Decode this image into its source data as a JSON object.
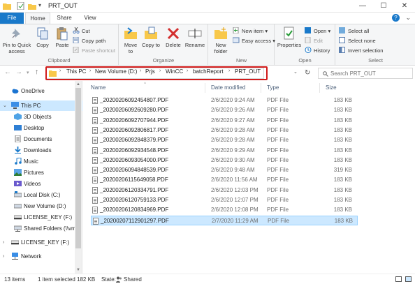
{
  "window": {
    "title": "PRT_OUT",
    "controls": {
      "minimize": "—",
      "maximize": "☐",
      "close": "✕"
    }
  },
  "tabs": {
    "file": "File",
    "home": "Home",
    "share": "Share",
    "view": "View"
  },
  "ribbon": {
    "clipboard": {
      "label": "Clipboard",
      "pin": "Pin to Quick access",
      "copy": "Copy",
      "paste": "Paste",
      "cut": "Cut",
      "copy_path": "Copy path",
      "paste_shortcut": "Paste shortcut"
    },
    "organize": {
      "label": "Organize",
      "move_to": "Move to",
      "copy_to": "Copy to",
      "delete": "Delete",
      "rename": "Rename"
    },
    "new": {
      "label": "New",
      "new_folder": "New folder",
      "new_item": "New item",
      "easy_access": "Easy access"
    },
    "open": {
      "label": "Open",
      "properties": "Properties",
      "open": "Open",
      "edit": "Edit",
      "history": "History"
    },
    "select": {
      "label": "Select",
      "select_all": "Select all",
      "select_none": "Select none",
      "invert_selection": "Invert selection"
    }
  },
  "address": {
    "crumbs": [
      "This PC",
      "New Volume (D:)",
      "Prjs",
      "WinCC",
      "batchReport",
      "PRT_OUT"
    ],
    "search_placeholder": "Search PRT_OUT"
  },
  "sidebar": {
    "items": [
      {
        "label": "OneDrive",
        "icon": "cloud-icon"
      },
      {
        "label": "This PC",
        "icon": "pc-icon"
      },
      {
        "label": "3D Objects",
        "icon": "cube-icon"
      },
      {
        "label": "Desktop",
        "icon": "desktop-icon"
      },
      {
        "label": "Documents",
        "icon": "documents-icon"
      },
      {
        "label": "Downloads",
        "icon": "download-icon"
      },
      {
        "label": "Music",
        "icon": "music-icon"
      },
      {
        "label": "Pictures",
        "icon": "pictures-icon"
      },
      {
        "label": "Videos",
        "icon": "videos-icon"
      },
      {
        "label": "Local Disk (C:)",
        "icon": "drive-icon"
      },
      {
        "label": "New Volume (D:)",
        "icon": "drive-icon"
      },
      {
        "label": "LICENSE_KEY (F:)",
        "icon": "usb-drive-icon"
      },
      {
        "label": "Shared Folders (\\\\vm",
        "icon": "network-drive-icon"
      },
      {
        "label": "LICENSE_KEY (F:)",
        "icon": "usb-drive-icon"
      },
      {
        "label": "Network",
        "icon": "network-icon"
      }
    ]
  },
  "columns": {
    "name": "Name",
    "date": "Date modified",
    "type": "Type",
    "size": "Size"
  },
  "files": [
    {
      "name": "_20200206092454807.PDF",
      "date": "2/6/2020 9:24 AM",
      "type": "PDF File",
      "size": "183 KB"
    },
    {
      "name": "_20200206092609280.PDF",
      "date": "2/6/2020 9:26 AM",
      "type": "PDF File",
      "size": "183 KB"
    },
    {
      "name": "_20200206092707944.PDF",
      "date": "2/6/2020 9:27 AM",
      "type": "PDF File",
      "size": "183 KB"
    },
    {
      "name": "_20200206092806817.PDF",
      "date": "2/6/2020 9:28 AM",
      "type": "PDF File",
      "size": "183 KB"
    },
    {
      "name": "_20200206092848379.PDF",
      "date": "2/6/2020 9:28 AM",
      "type": "PDF File",
      "size": "183 KB"
    },
    {
      "name": "_20200206092934548.PDF",
      "date": "2/6/2020 9:29 AM",
      "type": "PDF File",
      "size": "183 KB"
    },
    {
      "name": "_20200206093054000.PDF",
      "date": "2/6/2020 9:30 AM",
      "type": "PDF File",
      "size": "183 KB"
    },
    {
      "name": "_20200206094848539.PDF",
      "date": "2/6/2020 9:48 AM",
      "type": "PDF File",
      "size": "319 KB"
    },
    {
      "name": "_20200206115649058.PDF",
      "date": "2/6/2020 11:56 AM",
      "type": "PDF File",
      "size": "183 KB"
    },
    {
      "name": "_20200206120334791.PDF",
      "date": "2/6/2020 12:03 PM",
      "type": "PDF File",
      "size": "183 KB"
    },
    {
      "name": "_20200206120759133.PDF",
      "date": "2/6/2020 12:07 PM",
      "type": "PDF File",
      "size": "183 KB"
    },
    {
      "name": "_20200206120834969.PDF",
      "date": "2/6/2020 12:08 PM",
      "type": "PDF File",
      "size": "183 KB"
    },
    {
      "name": "_20200207112901297.PDF",
      "date": "2/7/2020 11:29 AM",
      "type": "PDF File",
      "size": "183 KB",
      "selected": true
    }
  ],
  "status": {
    "items": "13 items",
    "selected": "1 item selected  182 KB",
    "state": "State:",
    "shared": "Shared"
  },
  "colors": {
    "accent": "#1979ca",
    "selection": "#cce8ff",
    "highlight_box": "#d11b1b",
    "folder": "#f8c84a"
  }
}
